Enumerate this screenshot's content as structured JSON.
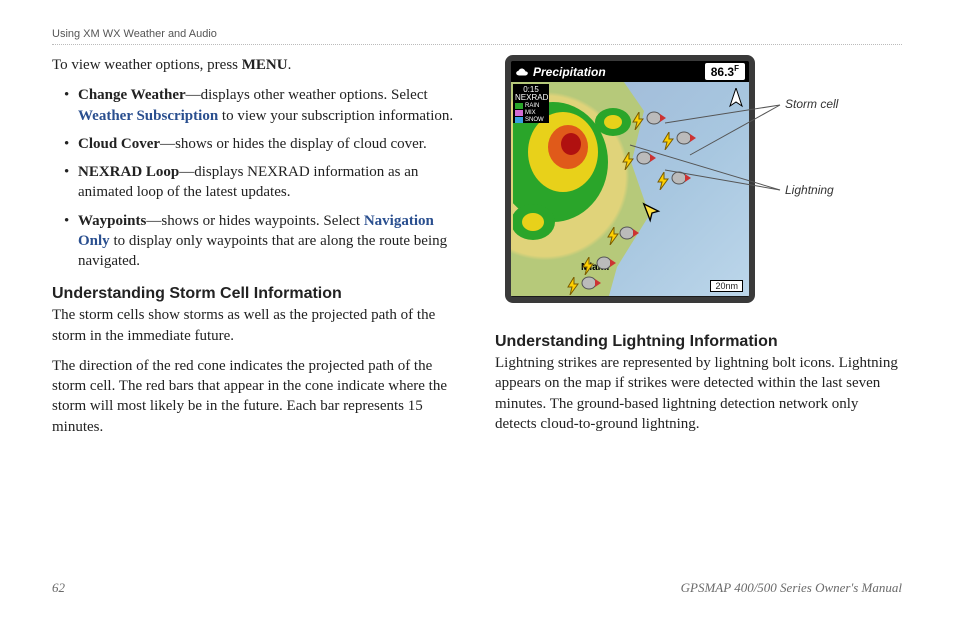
{
  "running_head": "Using XM WX Weather and Audio",
  "intro": {
    "pre": "To view weather options, press ",
    "menu": "MENU",
    "post": "."
  },
  "options": [
    {
      "term": "Change Weather",
      "rest": "—displays other weather options. Select ",
      "link": "Weather Subscription",
      "after_link": " to view your subscription information."
    },
    {
      "term": "Cloud Cover",
      "rest": "—shows or hides the display of cloud cover."
    },
    {
      "term": "NEXRAD Loop",
      "rest": "—displays NEXRAD information as an animated loop of the latest updates."
    },
    {
      "term": "Waypoints",
      "rest": "—shows or hides waypoints. Select ",
      "link": "Navigation Only",
      "after_link": " to display only waypoints that are along the route being navigated."
    }
  ],
  "storm": {
    "heading": "Understanding Storm Cell Information",
    "p1": "The storm cells show storms as well as the projected path of the storm in the immediate future.",
    "p2": "The direction of the red cone indicates the projected path of the storm cell. The red bars that appear in the cone indicate where the storm will most likely be in the future. Each bar represents 15 minutes."
  },
  "lightning": {
    "heading": "Understanding Lightning Information",
    "p1": "Lightning strikes are represented by lightning bolt icons. Lightning appears on the map if strikes were detected within the last seven minutes. The ground-based lightning detection network only detects cloud-to-ground lightning."
  },
  "figure": {
    "titlebar_label": "Precipitation",
    "titlebar_value": "86.3",
    "titlebar_unit": "F",
    "legend_time": "0:15",
    "legend_mode": "NEXRAD",
    "legend_items": [
      {
        "label": "RAIN",
        "color": "#2aa52a"
      },
      {
        "label": "MIX",
        "color": "#d46bd4"
      },
      {
        "label": "SNOW",
        "color": "#3aa0e0"
      }
    ],
    "city_label": "Miami",
    "scale_label": "20nm",
    "callouts": {
      "storm": "Storm cell",
      "lightning": "Lightning"
    }
  },
  "footer": {
    "page": "62",
    "manual": "GPSMAP 400/500 Series Owner's Manual"
  }
}
